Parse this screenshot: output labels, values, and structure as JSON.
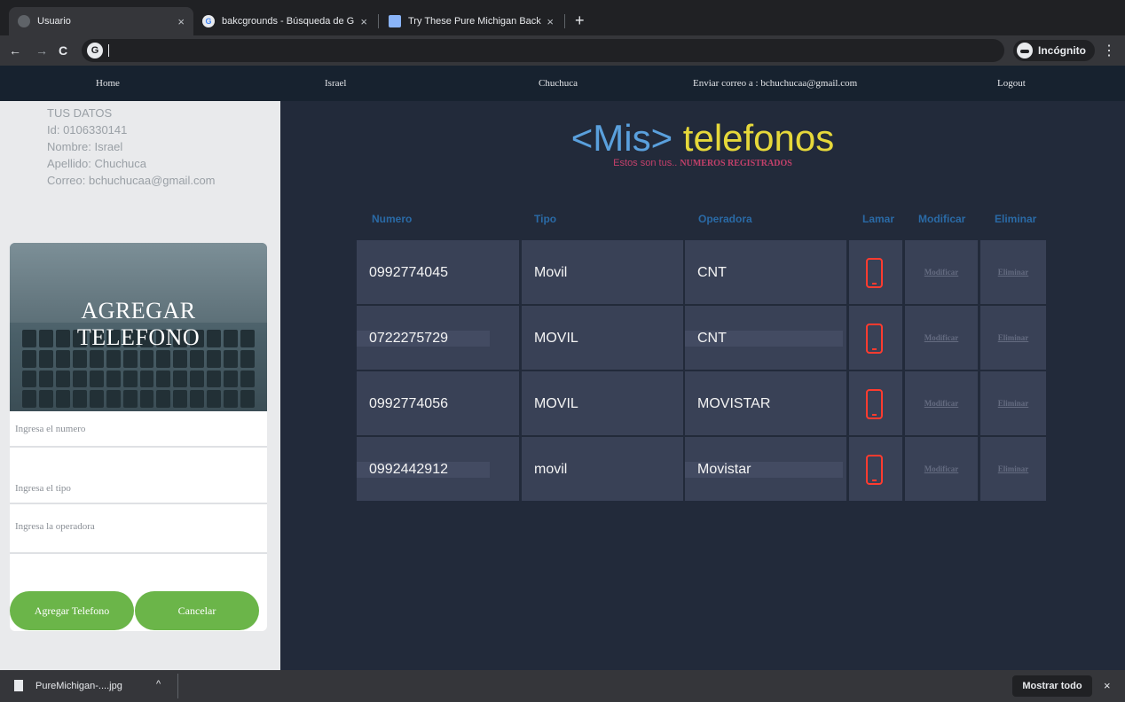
{
  "browser": {
    "tabs": [
      {
        "title": "Usuario",
        "active": true
      },
      {
        "title": "bakcgrounds - Búsqueda de G",
        "active": false
      },
      {
        "title": "Try These Pure Michigan Back",
        "active": false
      }
    ],
    "new_tab_label": "+",
    "close_glyph": "×",
    "back_glyph": "←",
    "forward_glyph": "→",
    "reload_glyph": "C",
    "omnibox_icon": "G",
    "incognito_label": "Incógnito",
    "menu_glyph": "⋮"
  },
  "nav": {
    "home": "Home",
    "first_name": "Israel",
    "last_name": "Chuchuca",
    "email_label": "Enviar correo a : bchuchucaa@gmail.com",
    "logout": "Logout"
  },
  "user": {
    "heading": "TUS DATOS",
    "id": "Id: 0106330141",
    "nombre": "Nombre: Israel",
    "apellido": "Apellido: Chuchuca",
    "correo": "Correo: bchuchucaa@gmail.com"
  },
  "form": {
    "title_line1": "AGREGAR",
    "title_line2": "TELEFONO",
    "numero_placeholder": "Ingresa el numero",
    "tipo_placeholder": "Ingresa el tipo",
    "operadora_placeholder": "Ingresa la operadora",
    "submit_label": "Agregar Telefono",
    "cancel_label": "Cancelar"
  },
  "main": {
    "heading_open": "<",
    "heading_mis": "Mis",
    "heading_close": ">",
    "heading_word": "telefonos",
    "subtitle_prefix": "Estos son tus..",
    "subtitle_strong": "NUMEROS REGISTRADOS",
    "columns": {
      "numero": "Numero",
      "tipo": "Tipo",
      "operadora": "Operadora",
      "llamar": "Lamar",
      "modificar": "Modificar",
      "eliminar": "Eliminar"
    },
    "rows": [
      {
        "numero": "0992774045",
        "tipo": "Movil",
        "operadora": "CNT",
        "modificar": "Modificar",
        "eliminar": "Eliminar"
      },
      {
        "numero": "0722275729",
        "tipo": "MOVIL",
        "operadora": "CNT",
        "modificar": "Modificar",
        "eliminar": "Eliminar"
      },
      {
        "numero": "0992774056",
        "tipo": "MOVIL",
        "operadora": "MOVISTAR",
        "modificar": "Modificar",
        "eliminar": "Eliminar"
      },
      {
        "numero": "0992442912",
        "tipo": "movil",
        "operadora": "Movistar",
        "modificar": "Modificar",
        "eliminar": "Eliminar"
      }
    ],
    "call_icon": "mobile-phone-icon"
  },
  "downloads": {
    "file_name": "PureMichigan-....jpg",
    "menu_glyph": "^",
    "show_all": "Mostrar todo",
    "close_glyph": "×"
  },
  "colors": {
    "accent_green": "#6bb549",
    "heading_blue": "#5aa0dd",
    "heading_yellow": "#e6d83a",
    "call_red": "#ff3b2f",
    "subtitle_pink": "#c2406a"
  }
}
